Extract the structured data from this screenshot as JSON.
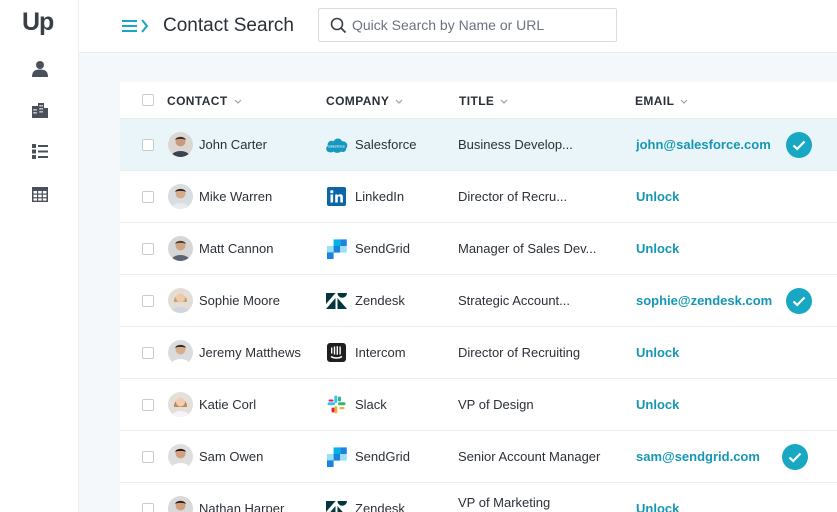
{
  "app": {
    "logo_text": "Up"
  },
  "header": {
    "title": "Contact Search",
    "search_placeholder": "Quick Search by Name or URL",
    "search_value": ""
  },
  "sidebar": {
    "items": [
      {
        "name": "contacts",
        "icon": "user-icon"
      },
      {
        "name": "companies",
        "icon": "building-icon"
      },
      {
        "name": "lists",
        "icon": "list-icon"
      },
      {
        "name": "table",
        "icon": "table-grid-icon"
      }
    ]
  },
  "table": {
    "columns": [
      "CONTACT",
      "COMPANY",
      "TITLE",
      "EMAIL"
    ],
    "rows": [
      {
        "name": "John Carter",
        "company": "Salesforce",
        "logo": "salesforce-logo",
        "title": "Business Develop...",
        "email": "john@salesforce.com",
        "verified": true,
        "selected": true
      },
      {
        "name": "Mike Warren",
        "company": "LinkedIn",
        "logo": "linkedin-logo",
        "title": "Director of Recru...",
        "email": "Unlock",
        "verified": false
      },
      {
        "name": "Matt Cannon",
        "company": "SendGrid",
        "logo": "sendgrid-logo",
        "title": "Manager of Sales Dev...",
        "email": "Unlock",
        "verified": false
      },
      {
        "name": "Sophie Moore",
        "company": "Zendesk",
        "logo": "zendesk-logo",
        "title": "Strategic Account...",
        "email": "sophie@zendesk.com",
        "verified": true
      },
      {
        "name": "Jeremy Matthews",
        "company": "Intercom",
        "logo": "intercom-logo",
        "title": "Director of Recruiting",
        "email": "Unlock",
        "verified": false
      },
      {
        "name": "Katie Corl",
        "company": "Slack",
        "logo": "slack-logo",
        "title": "VP of Design",
        "email": "Unlock",
        "verified": false
      },
      {
        "name": "Sam Owen",
        "company": "SendGrid",
        "logo": "sendgrid-logo",
        "title": "Senior Account Manager",
        "email": "sam@sendgrid.com",
        "verified": true
      },
      {
        "name": "Nathan Harper",
        "company": "Zendesk",
        "logo": "zendesk-logo",
        "title": "VP of Marketing",
        "email": "Unlock",
        "verified": false
      }
    ]
  },
  "colors": {
    "accent": "#18a8c4",
    "link": "#1597b4",
    "selected_row": "#eaf5fa"
  }
}
